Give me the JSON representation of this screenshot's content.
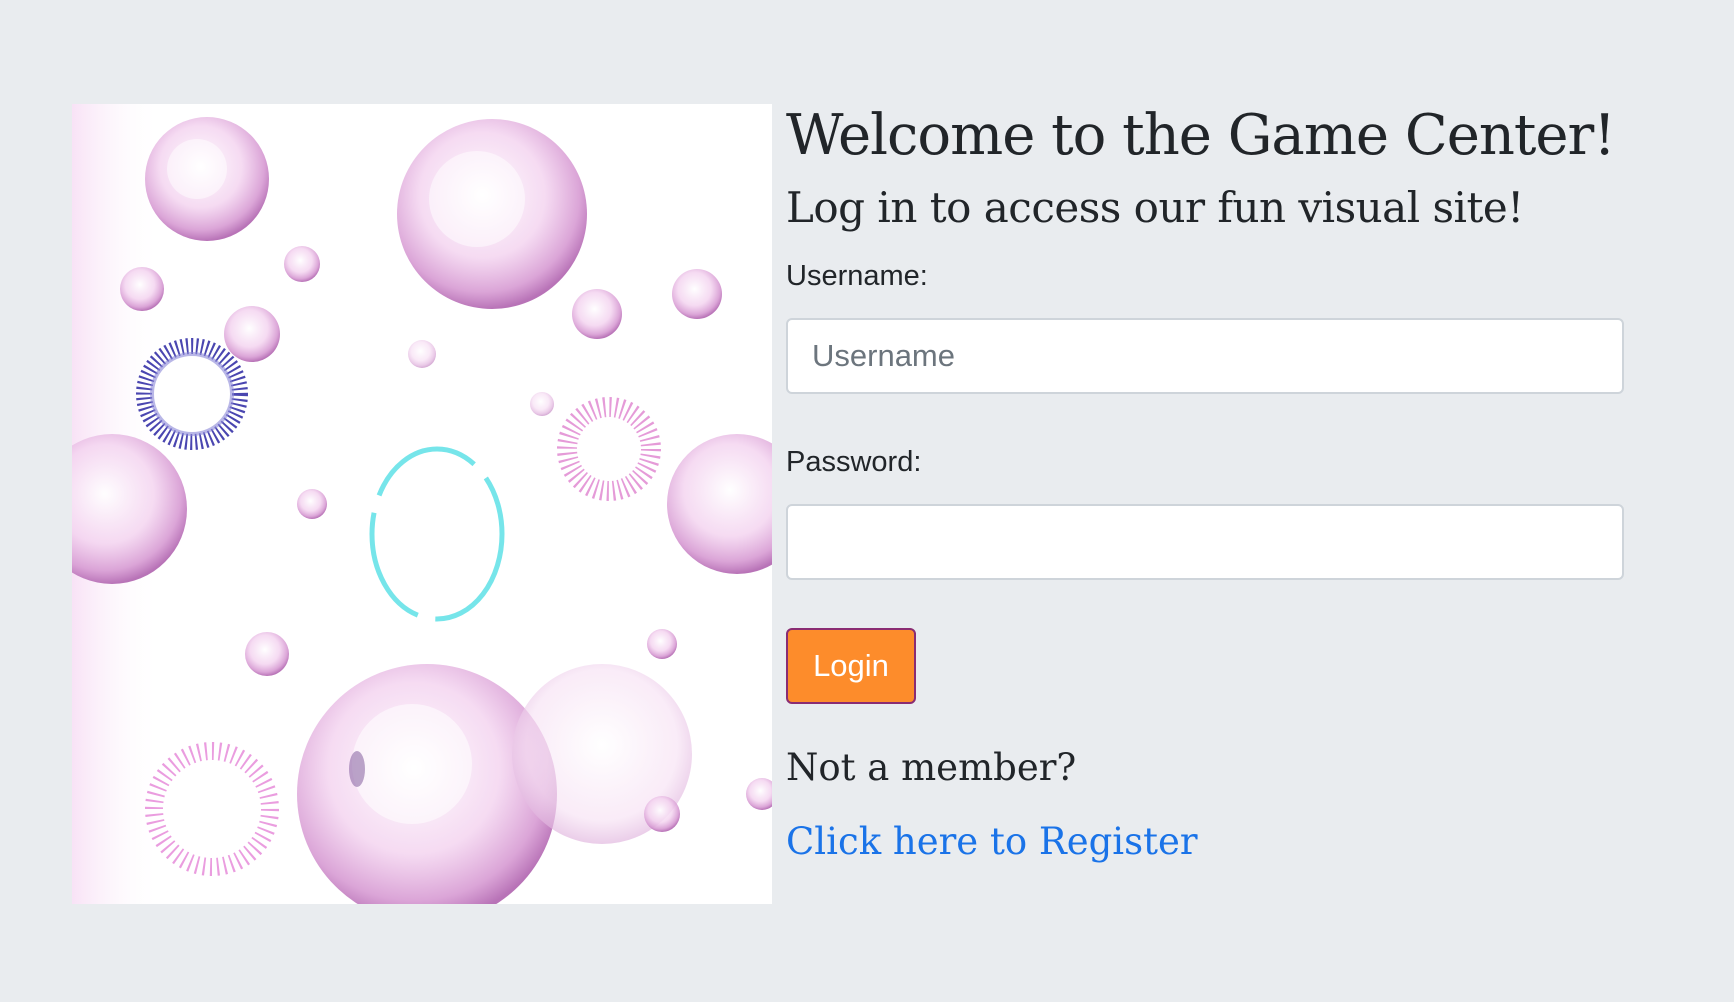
{
  "page": {
    "title": "Welcome to the Game Center!",
    "subtitle": "Log in to access our fun visual site!"
  },
  "form": {
    "username_label": "Username:",
    "username_placeholder": "Username",
    "username_value": "",
    "password_label": "Password:",
    "password_value": "",
    "login_label": "Login"
  },
  "register": {
    "prompt": "Not a member?",
    "link_text": "Click here to Register"
  },
  "colors": {
    "background": "#e9ecef",
    "login_button": "#fd8c2b",
    "login_border": "#8a2c72",
    "link": "#1a73e8"
  }
}
